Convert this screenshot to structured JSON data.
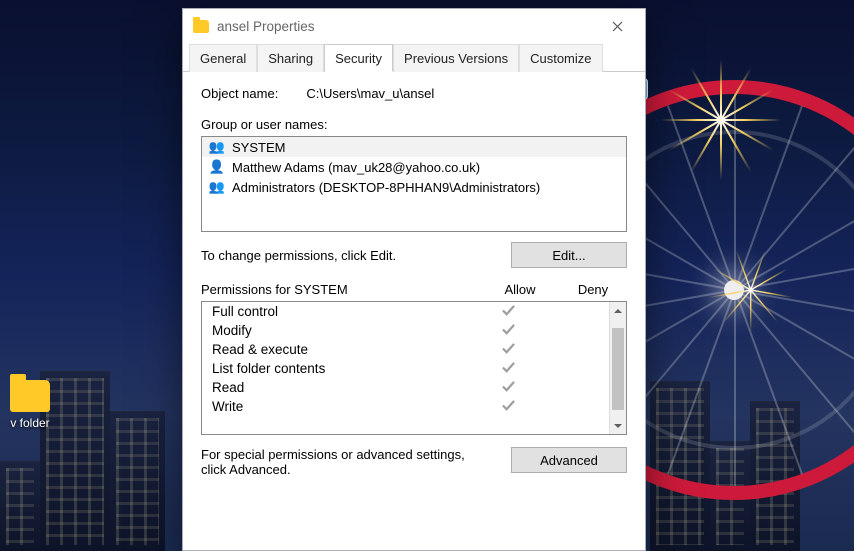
{
  "window": {
    "title": "ansel Properties"
  },
  "tabs": [
    "General",
    "Sharing",
    "Security",
    "Previous Versions",
    "Customize"
  ],
  "activeTabIndex": 2,
  "objectName": {
    "label": "Object name:",
    "value": "C:\\Users\\mav_u\\ansel"
  },
  "groupsLabel": "Group or user names:",
  "groups": [
    {
      "icon": "👥",
      "name": "SYSTEM",
      "selected": true
    },
    {
      "icon": "👤",
      "name": "Matthew Adams (mav_uk28@yahoo.co.uk)",
      "selected": false
    },
    {
      "icon": "👥",
      "name": "Administrators (DESKTOP-8PHHAN9\\Administrators)",
      "selected": false
    }
  ],
  "editHint": "To change permissions, click Edit.",
  "editBtn": "Edit...",
  "permHeader": {
    "name": "Permissions for SYSTEM",
    "allow": "Allow",
    "deny": "Deny"
  },
  "permissions": [
    {
      "name": "Full control",
      "allow": true,
      "deny": false
    },
    {
      "name": "Modify",
      "allow": true,
      "deny": false
    },
    {
      "name": "Read & execute",
      "allow": true,
      "deny": false
    },
    {
      "name": "List folder contents",
      "allow": true,
      "deny": false
    },
    {
      "name": "Read",
      "allow": true,
      "deny": false
    },
    {
      "name": "Write",
      "allow": true,
      "deny": false
    }
  ],
  "advHint": "For special permissions or advanced settings, click Advanced.",
  "advBtn": "Advanced",
  "desktop": {
    "folderLabel": "v folder"
  }
}
